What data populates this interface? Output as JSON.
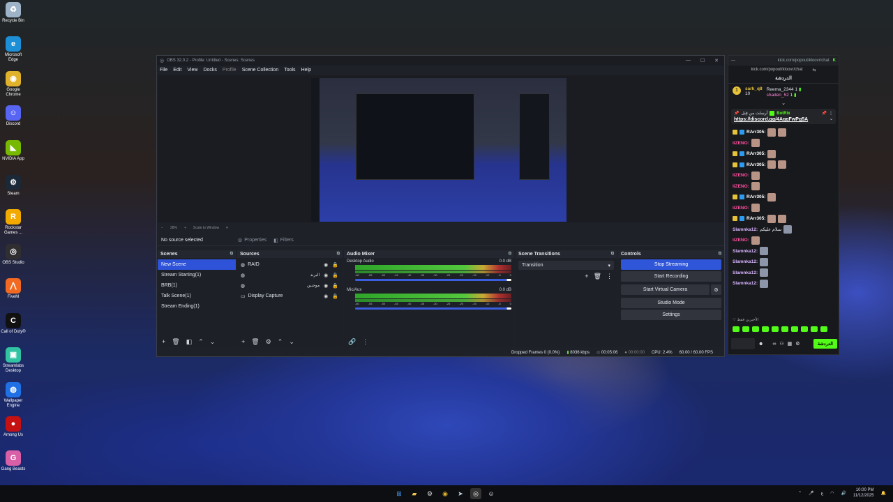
{
  "desktop_icons": [
    {
      "name": "recycle-bin-icon",
      "label": "Recycle Bin",
      "color": "#9fb3c8",
      "glyph": "♻"
    },
    {
      "name": "edge-icon",
      "label": "Microsoft Edge",
      "color": "#1c8fd6",
      "glyph": "e"
    },
    {
      "name": "chrome-icon",
      "label": "Google Chrome",
      "color": "#e0b12a",
      "glyph": "◉"
    },
    {
      "name": "discord-icon",
      "label": "Discord",
      "color": "#5865f2",
      "glyph": "☺"
    },
    {
      "name": "nvidia-icon",
      "label": "NVIDIA App",
      "color": "#76b900",
      "glyph": "◣"
    },
    {
      "name": "steam-icon",
      "label": "Steam",
      "color": "#1b2838",
      "glyph": "⚙"
    },
    {
      "name": "rockstar-icon",
      "label": "Rockstar Games ...",
      "color": "#f2a900",
      "glyph": "R"
    },
    {
      "name": "obs-icon",
      "label": "OBS Studio",
      "color": "#302e31",
      "glyph": "◎"
    },
    {
      "name": "fivem-icon",
      "label": "FiveM",
      "color": "#f26a21",
      "glyph": "⋀"
    },
    {
      "name": "cod-icon",
      "label": "Call of Duty®",
      "color": "#111111",
      "glyph": "C"
    },
    {
      "name": "streamlabs-icon",
      "label": "Streamlabs Desktop",
      "color": "#31c3a2",
      "glyph": "▣"
    },
    {
      "name": "wallpaper-engine-icon",
      "label": "Wallpaper Engine",
      "color": "#1f6fe5",
      "glyph": "◍"
    },
    {
      "name": "among-us-icon",
      "label": "Among Us",
      "color": "#c51111",
      "glyph": "●"
    },
    {
      "name": "gang-beasts-icon",
      "label": "Gang Beasts",
      "color": "#d95fa6",
      "glyph": "G"
    }
  ],
  "obs": {
    "title": "OBS 32.0.2 - Profile: Untitled - Scenes: Scenes",
    "menu": [
      "File",
      "Edit",
      "View",
      "Docks",
      "Profile",
      "Scene Collection",
      "Tools",
      "Help"
    ],
    "zoom": "38%",
    "scale_mode": "Scale to Window",
    "no_source": "No source selected",
    "properties": "Properties",
    "filters": "Filters",
    "scenes_title": "Scenes",
    "scenes": [
      "New Scene",
      "Stream Starting(1)",
      "BRB(1)",
      "Talk Scene(1)",
      "Stream Ending(1)"
    ],
    "sources_title": "Sources",
    "sources": [
      "RAID",
      "البرند",
      "موجبين",
      "Display Capture"
    ],
    "mixer_title": "Audio Mixer",
    "channels": [
      {
        "name": "Desktop Audio",
        "db": "0.0 dB"
      },
      {
        "name": "Mic/Aux",
        "db": "0.0 dB"
      }
    ],
    "scale_ticks": [
      "-60",
      "-55",
      "-50",
      "-45",
      "-40",
      "-35",
      "-30",
      "-25",
      "-20",
      "-15",
      "-10",
      "-5",
      "0"
    ],
    "transitions_title": "Scene Transitions",
    "transition": "Transition",
    "controls_title": "Controls",
    "controls": [
      "Stop Streaming",
      "Start Recording",
      "Start Virtual Camera",
      "Studio Mode",
      "Settings"
    ],
    "status": {
      "dropped": "Dropped Frames 0 (0.0%)",
      "kbps": "8036 kbps",
      "live": "00:05:06",
      "rec": "00:00:00",
      "cpu": "CPU: 2.4%",
      "fps": "60.00 / 60.00 FPS"
    }
  },
  "kick": {
    "url_title": "kick.com/popout/kloovr/chat",
    "url": "kick.com/popout/kloovr/chat",
    "header": "الدردشة",
    "leaders": [
      {
        "name": "sark_q8",
        "count": "10"
      },
      {
        "name": "Reema_2344",
        "count": "1"
      },
      {
        "name": "shaden_52",
        "count": "1"
      }
    ],
    "pin_by": "أرسلت من قِبل",
    "pin_user": "BotRix",
    "pin_link": "https://discord.gg/4AqqFwPg5A",
    "chat": [
      {
        "user": "RArr305:",
        "color": "#ffffff"
      },
      {
        "user": "IiZENO:",
        "color": "#ff4fa0"
      },
      {
        "user": "RArr305:",
        "color": "#ffffff"
      },
      {
        "user": "RArr305:",
        "color": "#ffffff"
      },
      {
        "user": "IiZENO:",
        "color": "#ff4fa0"
      },
      {
        "user": "IiZENO:",
        "color": "#ff4fa0"
      },
      {
        "user": "RArr305:",
        "color": "#ffffff"
      },
      {
        "user": "IiZENO:",
        "color": "#ff4fa0"
      },
      {
        "user": "RArr305:",
        "color": "#ffffff"
      },
      {
        "user": "Slamnka12:",
        "color": "#d7b4ff",
        "text": "سلام عليكم"
      },
      {
        "user": "IiZENO:",
        "color": "#ff4fa0"
      },
      {
        "user": "Slamnka12:",
        "color": "#d7b4ff"
      },
      {
        "user": "Slamnka12:",
        "color": "#d7b4ff"
      },
      {
        "user": "Slamnka12:",
        "color": "#d7b4ff"
      },
      {
        "user": "Slamnka12:",
        "color": "#d7b4ff"
      }
    ],
    "recent": "الأخيرين فقط",
    "send": "الدردشة"
  },
  "taskbar": {
    "lang": "ع",
    "time": "10:00 PM",
    "date": "11/12/2025"
  }
}
